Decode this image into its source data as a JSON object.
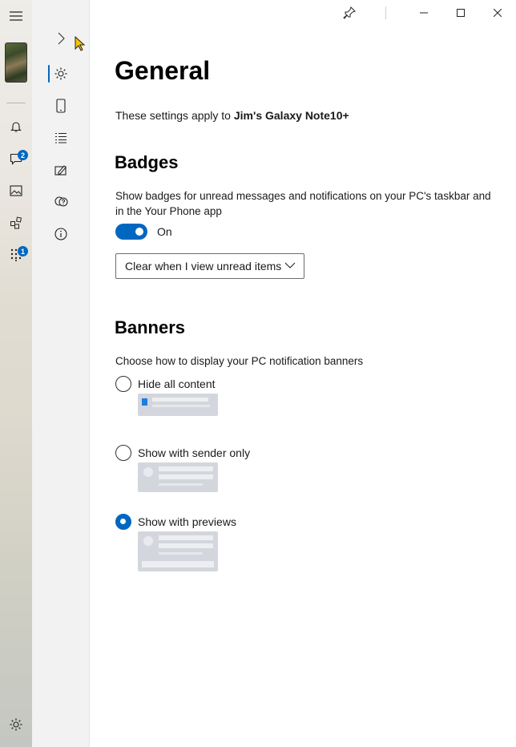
{
  "app": {
    "window_controls": {
      "pin_icon": "pin-icon",
      "minimize_icon": "minimize-icon",
      "maximize_icon": "maximize-icon",
      "close_icon": "close-icon"
    }
  },
  "rail": {
    "badges": {
      "messages": "2",
      "apps": "1"
    }
  },
  "page": {
    "title": "General",
    "applies_prefix": "These settings apply to ",
    "device_name": "Jim's Galaxy Note10+"
  },
  "badges": {
    "heading": "Badges",
    "description": "Show badges for unread messages and notifications on your PC's taskbar and in the Your Phone app",
    "toggle_label": "On",
    "toggle_on": true,
    "dropdown_value": "Clear when I view unread items"
  },
  "banners": {
    "heading": "Banners",
    "description": "Choose how to display your PC notification banners",
    "options": [
      {
        "label": "Hide all content",
        "checked": false
      },
      {
        "label": "Show with sender only",
        "checked": false
      },
      {
        "label": "Show with previews",
        "checked": true
      }
    ]
  },
  "colors": {
    "accent": "#0067c0",
    "nav_bg": "#f2f2f2"
  }
}
